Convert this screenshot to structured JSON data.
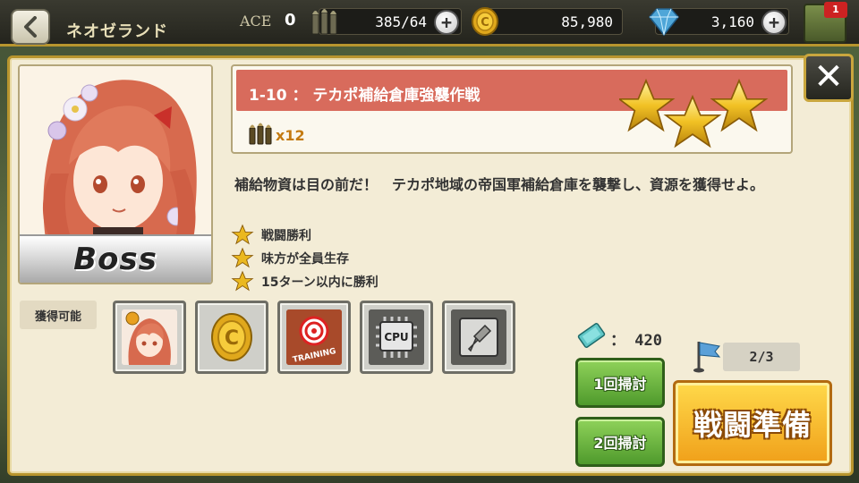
{
  "header": {
    "location": "ネオゼランド",
    "ace_label": "ACE",
    "ace_value": "0",
    "ammo": "385/64",
    "coins": "85,980",
    "gems": "3,160",
    "army_badge": "1"
  },
  "stage": {
    "title": "1-10 ： テカポ補給倉庫強襲作戦",
    "cost": "x12",
    "stars_earned": 3,
    "description": "補給物資は目の前だ！　テカポ地域の帝国軍補給倉庫を襲撃し、資源を獲得せよ。",
    "boss_label": "Boss"
  },
  "objectives": [
    "戦闘勝利",
    "味方が全員生存",
    "15ターン以内に勝利"
  ],
  "rewards": {
    "label": "獲得可能",
    "items": [
      {
        "icon": "character-card-icon"
      },
      {
        "icon": "gold-coin-icon"
      },
      {
        "icon": "training-manual-icon",
        "text": "TRAINING"
      },
      {
        "icon": "cpu-chip-icon",
        "text": "CPU"
      },
      {
        "icon": "armor-part-icon"
      }
    ]
  },
  "sweep": {
    "ticket_count": "： 420",
    "attempts": "2/3",
    "sweep_once_label": "1回掃討",
    "sweep_twice_label": "2回掃討"
  },
  "battle_button_label": "戦闘準備",
  "close_label": "✕",
  "colors": {
    "accent_gold": "#b8952e",
    "title_strip": "#d86b5c",
    "sweep_green": "#5aa632",
    "battle_orange": "#f0a01a"
  }
}
